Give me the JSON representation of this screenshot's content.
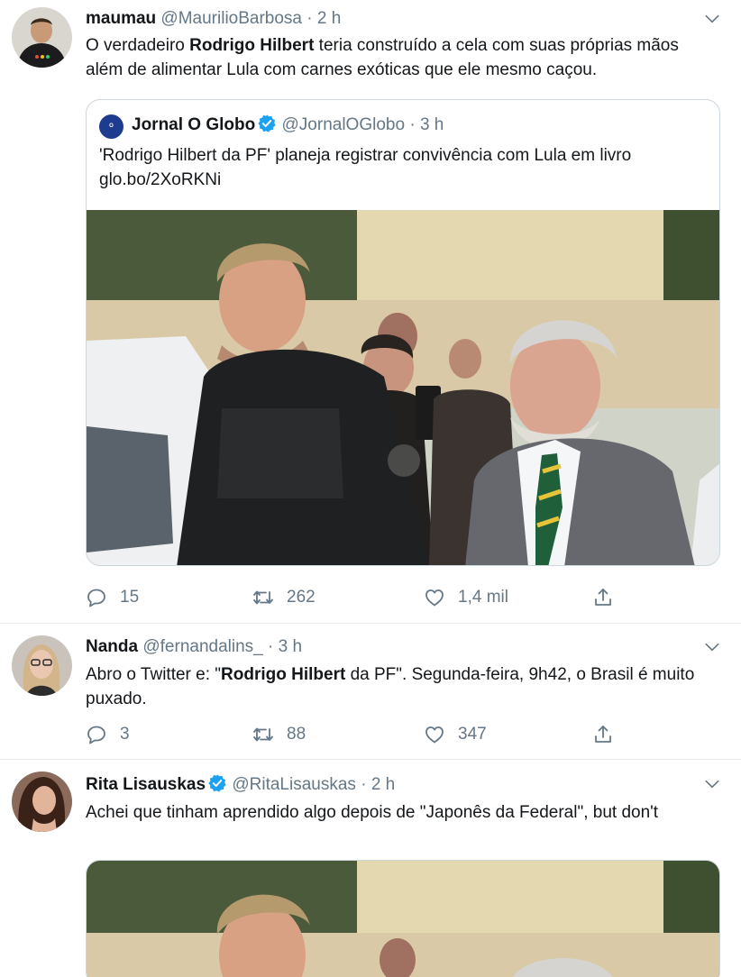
{
  "tweets": [
    {
      "name": "maumau",
      "handle": "@MaurilioBarbosa",
      "time": "2 h",
      "text_parts": [
        "O verdadeiro ",
        "Rodrigo Hilbert",
        " teria construído a cela com suas próprias mãos além de alimentar Lula com carnes exóticas que ele mesmo caçou."
      ],
      "quote": {
        "logo_text": "O GLOBO",
        "name": "Jornal O Globo",
        "handle": "@JornalOGlobo",
        "time": "3 h",
        "text": "'Rodrigo Hilbert da PF' planeja registrar convivência com Lula em livro",
        "link": "glo.bo/2XoRKNi"
      },
      "replies": "15",
      "retweets": "262",
      "likes": "1,4 mil"
    },
    {
      "name": "Nanda",
      "handle": "@fernandalins_",
      "time": "3 h",
      "text_parts": [
        "Abro o Twitter e: \"",
        "Rodrigo Hilbert",
        " da PF\". Segunda-feira, 9h42, o Brasil é muito puxado."
      ],
      "replies": "3",
      "retweets": "88",
      "likes": "347"
    },
    {
      "name": "Rita Lisauskas",
      "handle": "@RitaLisauskas",
      "time": "2 h",
      "text": "Achei que tinham aprendido algo depois de \"Japonês da Federal\", but don't"
    }
  ],
  "colors": {
    "verified": "#1da1f2",
    "secondary": "#657786",
    "border": "#e6ecf0"
  },
  "icons": [
    "chevron-down-icon",
    "reply-icon",
    "retweet-icon",
    "like-icon",
    "share-icon",
    "verified-icon"
  ]
}
